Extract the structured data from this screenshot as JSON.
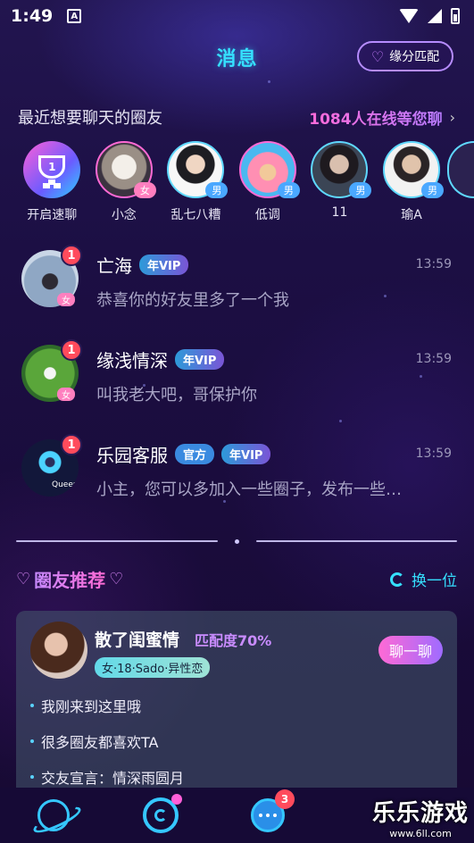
{
  "status_bar": {
    "time": "1:49",
    "notif_letter": "A"
  },
  "header": {
    "title": "消息",
    "match_button": "缘分匹配"
  },
  "recent": {
    "label": "最近想要聊天的圈友",
    "online_text": "1084人在线等您聊",
    "chevron": "›",
    "speed_chat_label": "开启速聊",
    "speed_chat_rank": "1",
    "friends": [
      {
        "name": "小念",
        "gender": "女"
      },
      {
        "name": "乱七八糟",
        "gender": "男"
      },
      {
        "name": "低调",
        "gender": "男"
      },
      {
        "name": "11",
        "gender": "男"
      },
      {
        "name": "瑜A",
        "gender": "男"
      }
    ]
  },
  "messages": [
    {
      "name": "亡海",
      "tags": [
        "年VIP"
      ],
      "time": "13:59",
      "preview": "恭喜你的好友里多了一个我",
      "unread": "1",
      "gender": "女"
    },
    {
      "name": "缘浅情深",
      "tags": [
        "年VIP"
      ],
      "time": "13:59",
      "preview": "叫我老大吧，哥保护你",
      "unread": "1",
      "gender": "女"
    },
    {
      "name": "乐园客服",
      "tags": [
        "官方",
        "年VIP"
      ],
      "time": "13:59",
      "preview": "小主，您可以多加入一些圈子，发布一些…",
      "unread": "1",
      "avatar_text": "Queer"
    }
  ],
  "recommend": {
    "title": "圈友推荐",
    "refresh_label": "换一位",
    "card": {
      "name": "散了闺蜜情",
      "match": "匹配度70%",
      "info": "女·18·Sado·异性恋",
      "chat_button": "聊一聊",
      "points": [
        "我刚来到这里哦",
        "很多圈友都喜欢TA",
        "交友宣言：情深雨圆月"
      ]
    }
  },
  "bottom_nav": {
    "items": [
      "planet-icon",
      "ring-icon",
      "chat-bubble-icon"
    ],
    "message_badge": "3"
  },
  "watermark": {
    "line1": "乐乐游戏",
    "line2": "www.6ll.com"
  }
}
